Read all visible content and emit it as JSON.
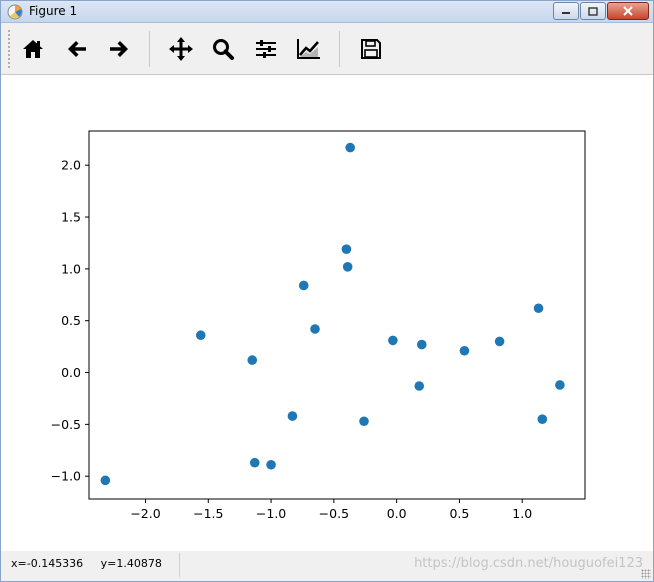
{
  "window": {
    "title": "Figure 1",
    "icons": {
      "app": "matplotlib-icon",
      "minimize": "minimize-icon",
      "maximize": "maximize-icon",
      "close": "close-icon"
    }
  },
  "toolbar": {
    "tools": [
      {
        "name": "home-icon",
        "tooltip": ""
      },
      {
        "name": "back-arrow-icon",
        "tooltip": ""
      },
      {
        "name": "forward-arrow-icon",
        "tooltip": ""
      },
      {
        "name": "pan-icon",
        "tooltip": ""
      },
      {
        "name": "zoom-icon",
        "tooltip": ""
      },
      {
        "name": "subplots-config-icon",
        "tooltip": ""
      },
      {
        "name": "edit-axis-icon",
        "tooltip": ""
      },
      {
        "name": "save-icon",
        "tooltip": ""
      }
    ]
  },
  "status": {
    "coords": "x=-0.145336     y=1.40878",
    "watermark": "https://blog.csdn.net/houguofei123"
  },
  "chart_data": {
    "type": "scatter",
    "title": "",
    "xlabel": "",
    "ylabel": "",
    "xlim": [
      -2.45,
      1.5
    ],
    "ylim": [
      -1.22,
      2.33
    ],
    "xticks": [
      -2.0,
      -1.5,
      -1.0,
      -0.5,
      0.0,
      0.5,
      1.0
    ],
    "xtick_labels": [
      "−2.0",
      "−1.5",
      "−1.0",
      "−0.5",
      "0.0",
      "0.5",
      "1.0"
    ],
    "yticks": [
      -1.0,
      -0.5,
      0.0,
      0.5,
      1.0,
      1.5,
      2.0
    ],
    "ytick_labels": [
      "−1.0",
      "−0.5",
      "0.0",
      "0.5",
      "1.0",
      "1.5",
      "2.0"
    ],
    "grid": false,
    "color": "#1f77b4",
    "x": [
      -2.32,
      -1.56,
      -1.15,
      -1.13,
      -1.0,
      -0.83,
      -0.74,
      -0.65,
      -0.4,
      -0.39,
      -0.37,
      -0.26,
      -0.03,
      0.18,
      0.2,
      0.54,
      0.82,
      1.13,
      1.16,
      1.3
    ],
    "y": [
      -1.04,
      0.36,
      0.12,
      -0.87,
      -0.89,
      -0.42,
      0.84,
      0.42,
      1.19,
      1.02,
      2.17,
      -0.47,
      0.31,
      -0.13,
      0.27,
      0.21,
      0.3,
      0.62,
      -0.45,
      -0.12
    ]
  }
}
